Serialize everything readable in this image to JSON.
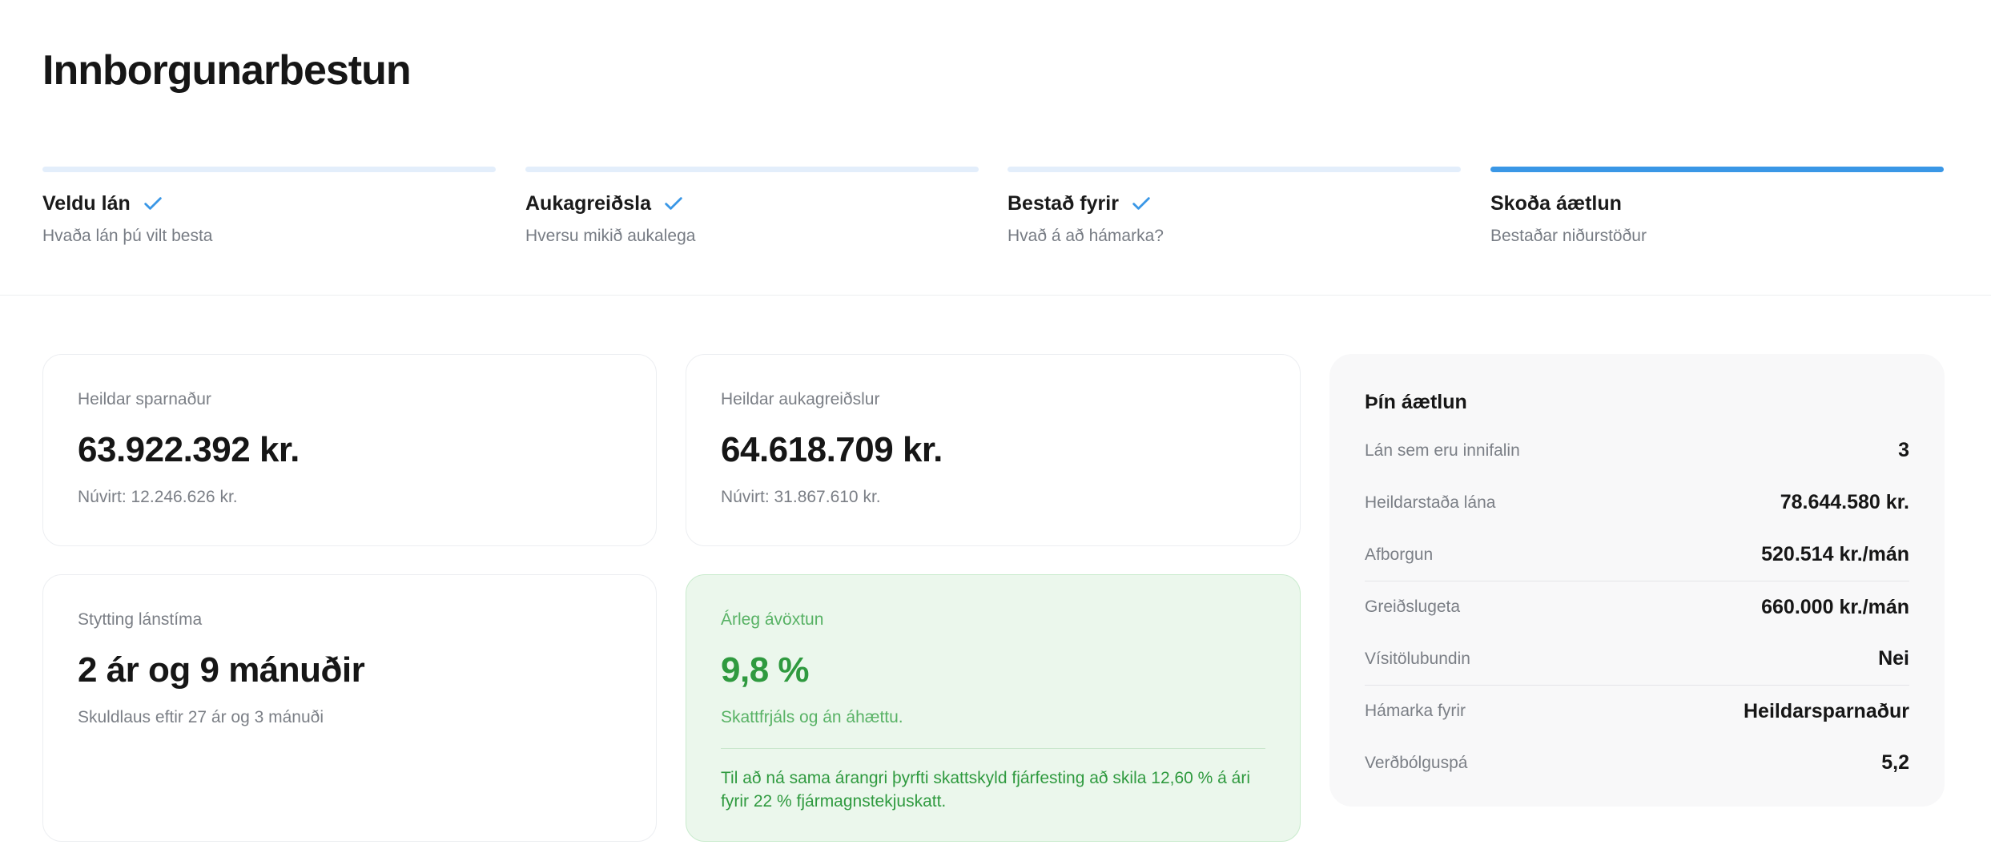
{
  "page": {
    "title": "Innborgunarbestun"
  },
  "steps": [
    {
      "title": "Veldu lán",
      "subtitle": "Hvaða lán þú vilt besta",
      "completed": true,
      "active": false
    },
    {
      "title": "Aukagreiðsla",
      "subtitle": "Hversu mikið aukalega",
      "completed": true,
      "active": false
    },
    {
      "title": "Bestað fyrir",
      "subtitle": "Hvað á að hámarka?",
      "completed": true,
      "active": false
    },
    {
      "title": "Skoða áætlun",
      "subtitle": "Bestaðar niðurstöður",
      "completed": false,
      "active": true
    }
  ],
  "cards": {
    "savings": {
      "label": "Heildar sparnaður",
      "value": "63.922.392 kr.",
      "sub": "Núvirt: 12.246.626 kr."
    },
    "extra_payments": {
      "label": "Heildar aukagreiðslur",
      "value": "64.618.709 kr.",
      "sub": "Núvirt: 31.867.610 kr."
    },
    "term_reduction": {
      "label": "Stytting lánstíma",
      "value": "2 ár og 9 mánuðir",
      "sub": "Skuldlaus eftir 27 ár og 3 mánuði"
    },
    "annual_return": {
      "label": "Árleg ávöxtun",
      "value": "9,8 %",
      "sub": "Skattfrjáls og án áhættu.",
      "note": "Til að ná sama árangri þyrfti skattskyld fjárfesting að skila 12,60 % á ári fyrir 22 % fjármagnstekjuskatt."
    }
  },
  "plan": {
    "title": "Þín áætlun",
    "rows": [
      {
        "key": "Lán sem eru innifalin",
        "value": "3"
      },
      {
        "key": "Heildarstaða lána",
        "value": "78.644.580 kr."
      },
      {
        "key": "Afborgun",
        "value": "520.514 kr./mán"
      },
      {
        "key": "Greiðslugeta",
        "value": "660.000 kr./mán"
      },
      {
        "key": "Vísitölubundin",
        "value": "Nei"
      },
      {
        "key": "Hámarka fyrir",
        "value": "Heildarsparnaður"
      },
      {
        "key": "Verðbólguspá",
        "value": "5,2"
      }
    ]
  },
  "colors": {
    "accent": "#3a97e6",
    "step_inactive_bar": "#e3eefb",
    "success": "#2f9a3f",
    "success_bg": "#ebf7ec"
  },
  "icons": {
    "step_completed": "check-icon"
  }
}
